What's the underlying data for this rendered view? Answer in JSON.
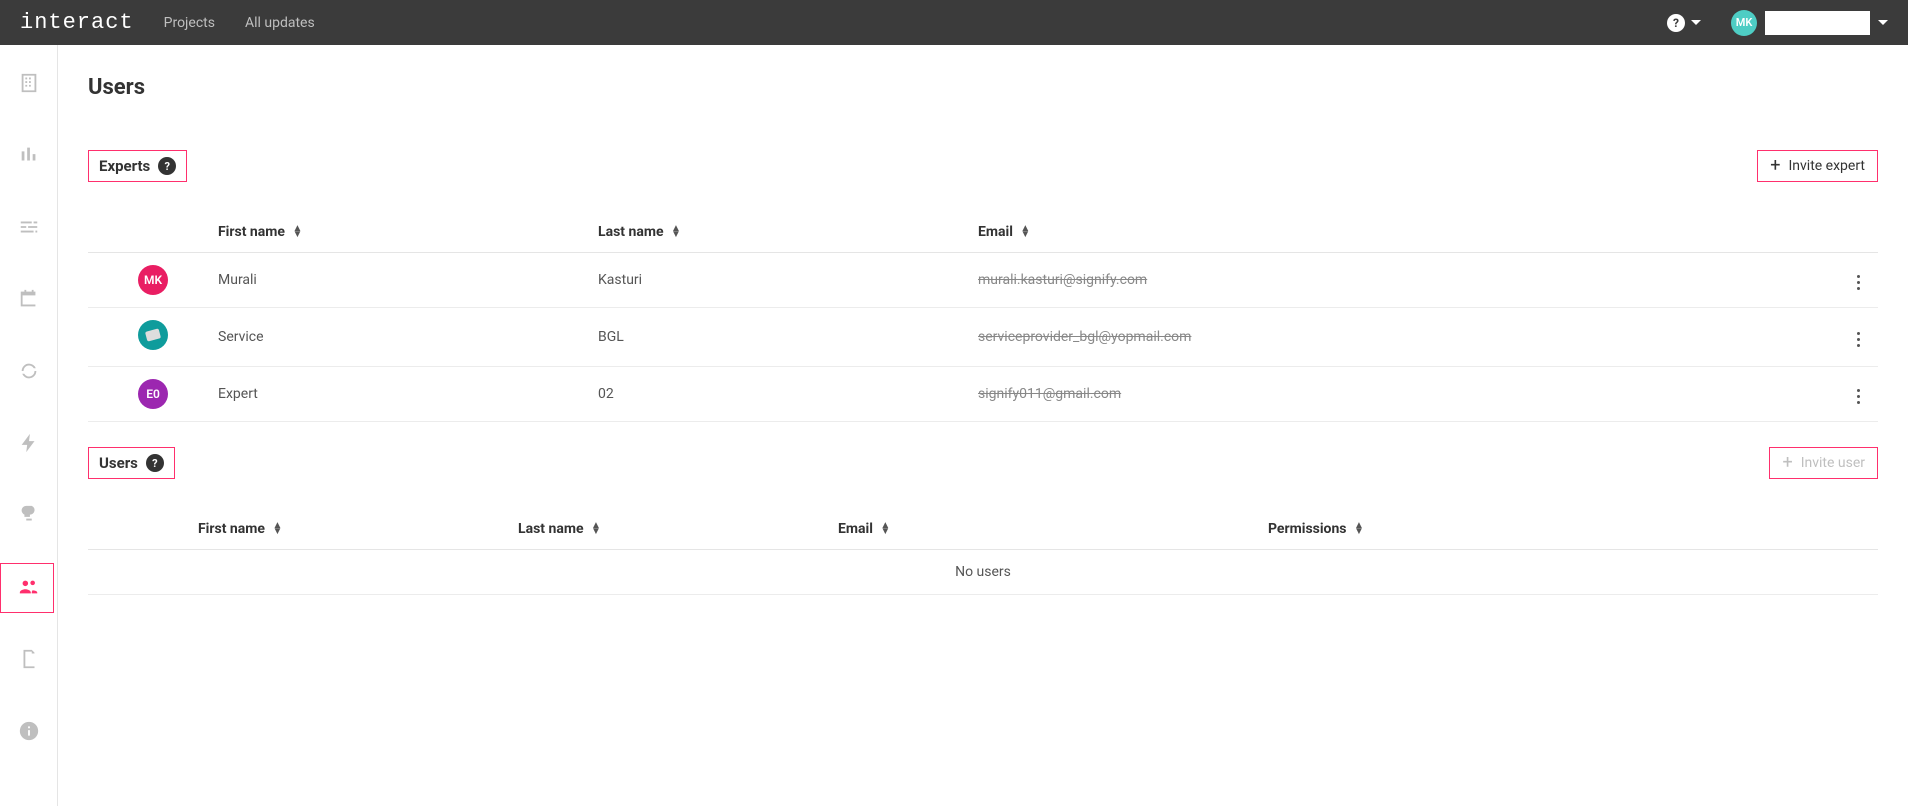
{
  "header": {
    "logo": "interact",
    "nav": [
      "Projects",
      "All updates"
    ],
    "avatar_initials": "MK"
  },
  "page": {
    "title": "Users"
  },
  "experts_section": {
    "title": "Experts",
    "invite_label": "Invite expert",
    "columns": {
      "first": "First name",
      "last": "Last name",
      "email": "Email"
    },
    "rows": [
      {
        "avatar_bg": "#e91e63",
        "avatar_text": "MK",
        "first": "Murali",
        "last": "Kasturi",
        "email": "murali.kasturi@signify.com"
      },
      {
        "avatar_bg": "teal-img",
        "avatar_text": "",
        "first": "Service",
        "last": "BGL",
        "email": "serviceprovider_bgl@yopmail.com"
      },
      {
        "avatar_bg": "#9c27b0",
        "avatar_text": "E0",
        "first": "Expert",
        "last": "02",
        "email": "signify011@gmail.com"
      }
    ]
  },
  "users_section": {
    "title": "Users",
    "invite_label": "Invite user",
    "columns": {
      "first": "First name",
      "last": "Last name",
      "email": "Email",
      "permissions": "Permissions"
    },
    "empty_text": "No users"
  }
}
